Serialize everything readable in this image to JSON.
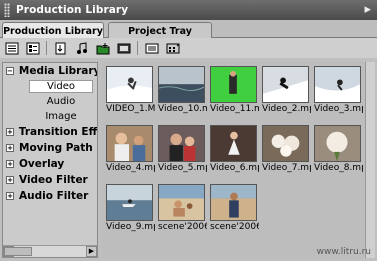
{
  "window": {
    "title": "Production Library"
  },
  "tabs": [
    {
      "label": "Production Library"
    },
    {
      "label": "Project Tray"
    }
  ],
  "toolbar": {
    "icons": [
      "list-view-icon",
      "details-view-icon",
      "import-icon",
      "music-icon",
      "add-folder-icon",
      "film-icon",
      "capture-icon",
      "scene-icon"
    ]
  },
  "tree": {
    "groups": [
      {
        "label": "Media Library",
        "expanded": true,
        "children": [
          "Video",
          "Audio",
          "Image"
        ],
        "selected": "Video"
      },
      {
        "label": "Transition Effe"
      },
      {
        "label": "Moving Path"
      },
      {
        "label": "Overlay"
      },
      {
        "label": "Video Filter"
      },
      {
        "label": "Audio Filter"
      }
    ]
  },
  "library": {
    "items": [
      {
        "caption": "VIDEO_1.M",
        "scene": "snow"
      },
      {
        "caption": "Video_10.m",
        "scene": "sea"
      },
      {
        "caption": "Video_11.m",
        "scene": "greenscreen"
      },
      {
        "caption": "Video_2.mp",
        "scene": "snow2"
      },
      {
        "caption": "Video_3.mp",
        "scene": "snow3"
      },
      {
        "caption": "Video_4.mp",
        "scene": "people"
      },
      {
        "caption": "Video_5.mp",
        "scene": "couple"
      },
      {
        "caption": "Video_6.mp",
        "scene": "dancer"
      },
      {
        "caption": "Video_7.mp",
        "scene": "flowers"
      },
      {
        "caption": "Video_8.mp",
        "scene": "bouquet"
      },
      {
        "caption": "Video_9.mp",
        "scene": "jetski"
      },
      {
        "caption": "scene'2006",
        "scene": "beach1"
      },
      {
        "caption": "scene'2006",
        "scene": "beach2"
      }
    ]
  },
  "watermark": "www.litru.ru"
}
